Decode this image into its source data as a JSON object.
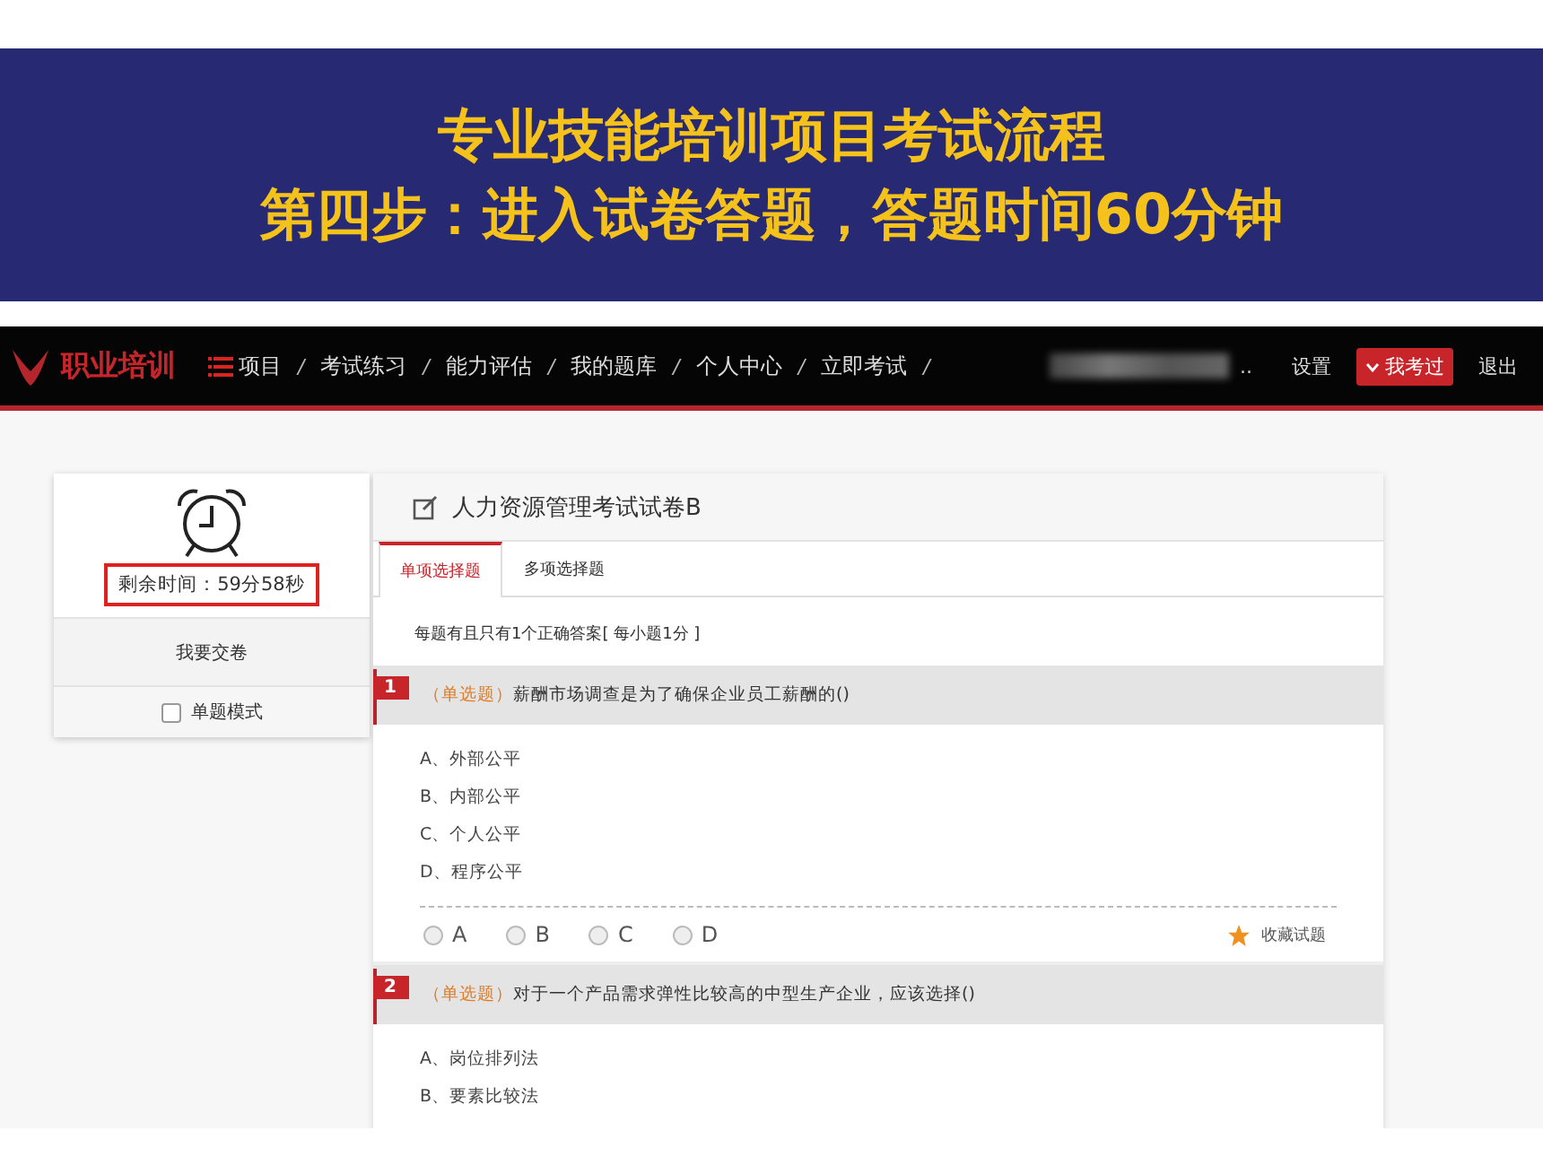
{
  "banner": {
    "lines": [
      "专业技能培训项目考试流程",
      "第四步：进入试卷答题，答题时间60分钟"
    ]
  },
  "nav": {
    "logo": "职业培训",
    "items": [
      {
        "label": "项目",
        "separator": "/",
        "kind": "menu"
      },
      {
        "label": "考试练习",
        "separator": "/",
        "kind": "plain"
      },
      {
        "label": "能力评估",
        "separator": "/",
        "kind": "plain"
      },
      {
        "label": "我的题库",
        "separator": "/",
        "kind": "plain"
      },
      {
        "label": "个人中心",
        "separator": "/",
        "kind": "plain"
      },
      {
        "label": "立即考试",
        "separator": "/",
        "kind": "plain"
      }
    ],
    "user_ellipsis": "..",
    "links": [
      {
        "label": "设置",
        "kind": "plain"
      },
      {
        "label": "我考过",
        "kind": "dropdown"
      },
      {
        "label": "退出",
        "kind": "plain"
      }
    ]
  },
  "sidebar": {
    "timer": {
      "label": "剩余时间：59分58秒",
      "highlighted": true
    },
    "submit": "我要交卷",
    "single_mode": {
      "label": "单题模式",
      "checked": false
    }
  },
  "exam": {
    "title": "人力资源管理考试试卷B",
    "tabs": [
      {
        "label": "单项选择题",
        "selected": true
      },
      {
        "label": "多项选择题",
        "selected": false
      }
    ],
    "instruction": "每题有且只有1个正确答案[ 每小题1分 ]",
    "questions": [
      {
        "number": "1",
        "type": "（单选题）",
        "text": "薪酬市场调查是为了确保企业员工薪酬的()",
        "options": [
          "A、外部公平",
          "B、内部公平",
          "C、个人公平",
          "D、程序公平"
        ],
        "answers": [
          {
            "label": "A",
            "selected": false
          },
          {
            "label": "B",
            "selected": false
          },
          {
            "label": "C",
            "selected": false
          },
          {
            "label": "D",
            "selected": false
          }
        ],
        "favorite": "收藏试题"
      },
      {
        "number": "2",
        "type": "（单选题）",
        "text": "对于一个产品需求弹性比较高的中型生产企业，应该选择()",
        "options": [
          "A、岗位排列法",
          "B、要素比较法"
        ]
      }
    ]
  }
}
